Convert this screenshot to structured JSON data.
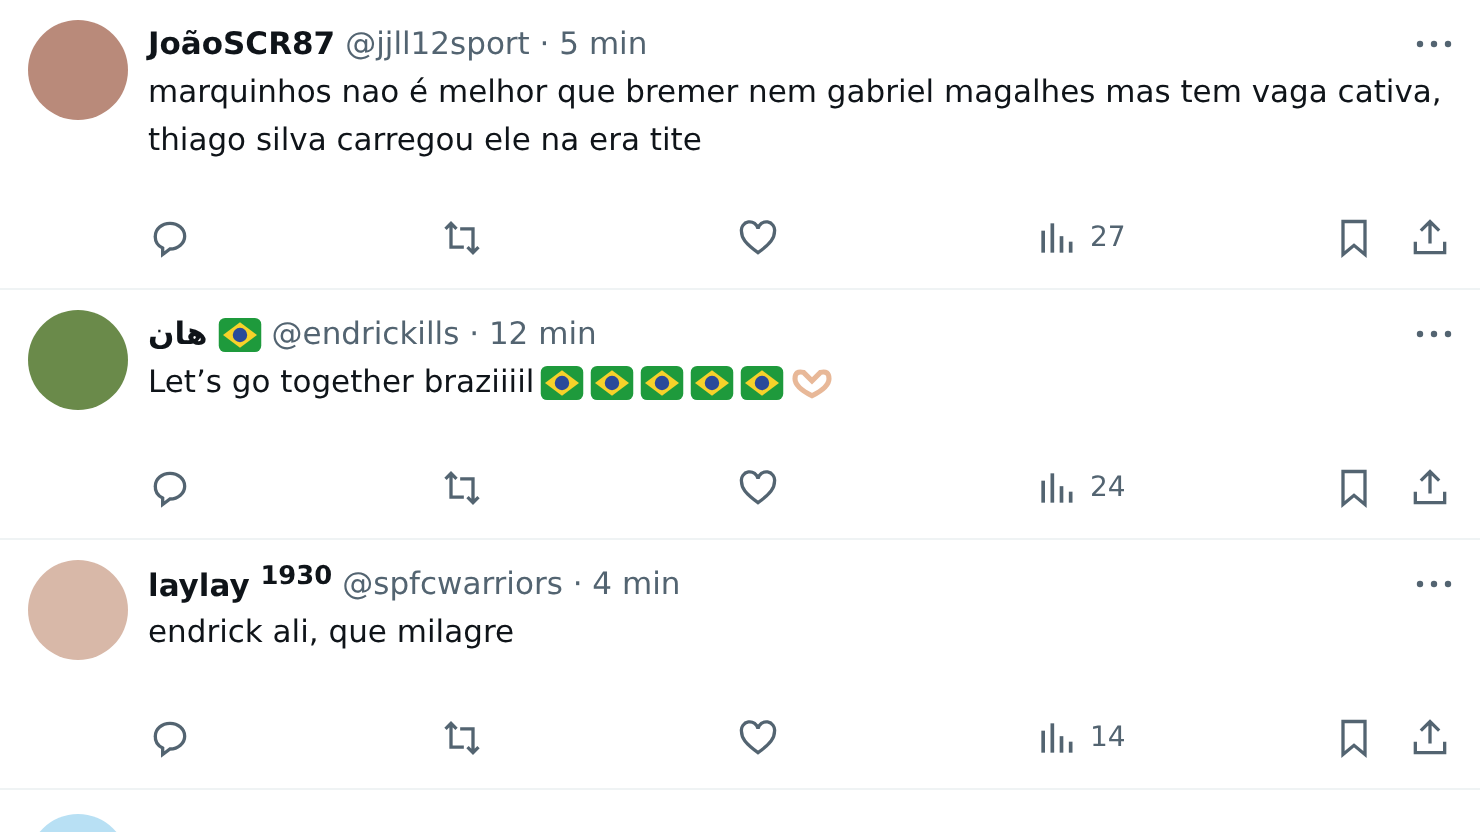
{
  "replies": [
    {
      "name": "JoãoSCR87",
      "meta": "@jjll12sport · 5 min",
      "text": "marquinhos nao é melhor que bremer nem gabriel magalhes mas tem vaga cativa, thiago silva carregou ele na era tite",
      "views": "27"
    },
    {
      "name": "هان",
      "meta": "@endrickills · 12 min",
      "text": "Let’s go together braziiiil",
      "views": "24"
    },
    {
      "name": "laylay $^{1930}$",
      "meta": "@spfcwarriors · 4 min",
      "text": "endrick ali, que milagre",
      "views": "14"
    }
  ]
}
